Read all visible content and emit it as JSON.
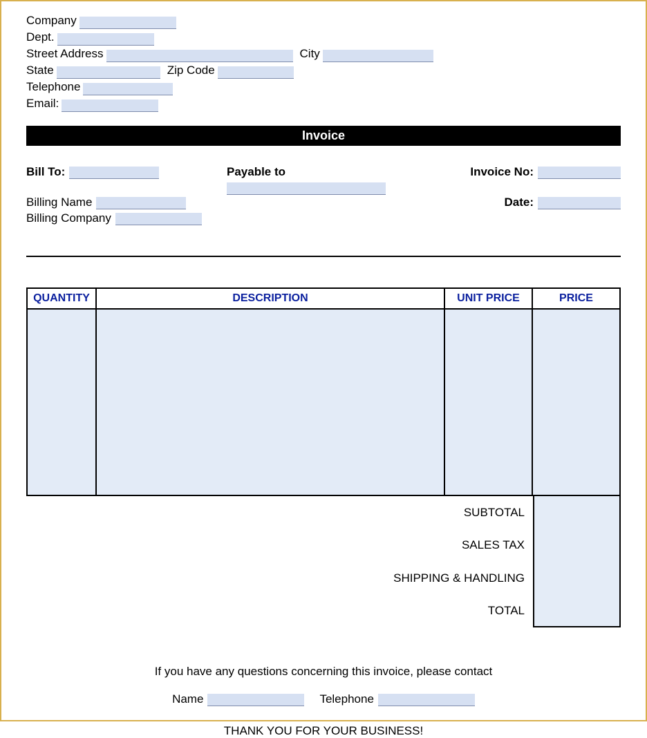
{
  "header": {
    "company_label": "Company",
    "dept_label": "Dept.",
    "street_label": "Street Address",
    "city_label": "City",
    "state_label": "State",
    "zip_label": "Zip Code",
    "telephone_label": "Telephone",
    "email_label": "Email:"
  },
  "banner_title": "Invoice",
  "bill": {
    "bill_to_label": "Bill To:",
    "payable_to_label": "Payable to",
    "invoice_no_label": "Invoice No:",
    "billing_name_label": "Billing Name",
    "billing_company_label": "Billing Company",
    "date_label": "Date:"
  },
  "table": {
    "col_quantity": "QUANTITY",
    "col_description": "DESCRIPTION",
    "col_unit_price": "UNIT PRICE",
    "col_price": "PRICE"
  },
  "totals": {
    "subtotal": "SUBTOTAL",
    "sales_tax": "SALES TAX",
    "shipping": "SHIPPING & HANDLING",
    "total": "TOTAL"
  },
  "footer": {
    "question_line": "If you have any questions concerning this invoice, please contact",
    "name_label": "Name",
    "telephone_label": "Telephone",
    "thank_you": "THANK YOU FOR YOUR BUSINESS!"
  }
}
